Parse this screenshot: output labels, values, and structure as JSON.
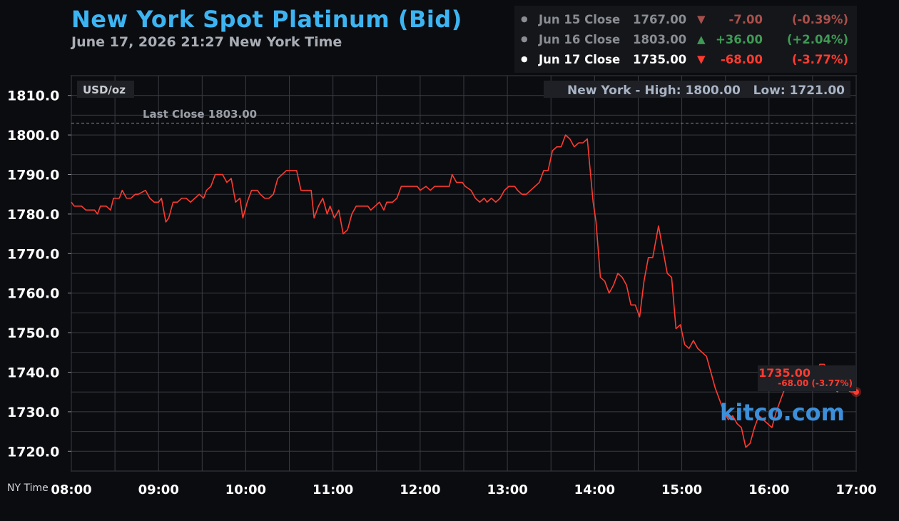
{
  "header": {
    "title": "New York Spot Platinum (Bid)",
    "subtitle": "June 17, 2026 21:27 New York Time"
  },
  "closes": [
    {
      "label": "Jun 15 Close",
      "value": "1767.00",
      "arrow": "▼",
      "change": "-7.00",
      "percent": "(-0.39%)",
      "dot": "●"
    },
    {
      "label": "Jun 16 Close",
      "value": "1803.00",
      "arrow": "▲",
      "change": "+36.00",
      "percent": "(+2.04%)",
      "dot": "●"
    },
    {
      "label": "Jun 17 Close",
      "value": "1735.00",
      "arrow": "▼",
      "change": "-68.00",
      "percent": "(-3.77%)",
      "dot": "●"
    }
  ],
  "colors": {
    "title": "#3db4f2",
    "line": "#ff3b30",
    "grid": "#3a3c42",
    "brand": "#3c8fd8",
    "up": "#3f9a55",
    "down": "#ff3b30"
  },
  "chart_data": {
    "type": "line",
    "title": "New York Spot Platinum (Bid)",
    "units_label": "USD/oz",
    "x_axis_label": "NY Time",
    "high_low_label": "New York - High: 1800.00   Low: 1721.00",
    "last_close_label": "Last Close 1803.00",
    "last_close": 1803.0,
    "current_price_label": "1735.00",
    "current_change_label": "-68.00 (-3.77%)",
    "brand": "kitco.com",
    "xlim": [
      "08:00",
      "17:00"
    ],
    "ylim": [
      1715,
      1815
    ],
    "x_ticks": [
      "08:00",
      "09:00",
      "10:00",
      "11:00",
      "12:00",
      "13:00",
      "14:00",
      "15:00",
      "16:00",
      "17:00"
    ],
    "y_ticks": [
      "1720.0",
      "1730.0",
      "1740.0",
      "1750.0",
      "1760.0",
      "1770.0",
      "1780.0",
      "1790.0",
      "1800.0",
      "1810.0"
    ],
    "grid": true,
    "series": [
      {
        "points": [
          [
            "08:00",
            1783
          ],
          [
            "08:02",
            1782
          ],
          [
            "08:07",
            1782
          ],
          [
            "08:10",
            1781
          ],
          [
            "08:14",
            1781
          ],
          [
            "08:16",
            1781
          ],
          [
            "08:18",
            1780
          ],
          [
            "08:20",
            1782
          ],
          [
            "08:24",
            1782
          ],
          [
            "08:27",
            1781
          ],
          [
            "08:29",
            1784
          ],
          [
            "08:33",
            1784
          ],
          [
            "08:35",
            1786
          ],
          [
            "08:38",
            1784
          ],
          [
            "08:41",
            1784
          ],
          [
            "08:44",
            1785
          ],
          [
            "08:46",
            1785
          ],
          [
            "08:51",
            1786
          ],
          [
            "08:54",
            1784
          ],
          [
            "08:57",
            1783
          ],
          [
            "09:00",
            1783
          ],
          [
            "09:02",
            1784
          ],
          [
            "09:05",
            1778
          ],
          [
            "09:07",
            1779
          ],
          [
            "09:10",
            1783
          ],
          [
            "09:13",
            1783
          ],
          [
            "09:16",
            1784
          ],
          [
            "09:19",
            1784
          ],
          [
            "09:22",
            1783
          ],
          [
            "09:25",
            1784
          ],
          [
            "09:28",
            1785
          ],
          [
            "09:31",
            1784
          ],
          [
            "09:33",
            1786
          ],
          [
            "09:36",
            1787
          ],
          [
            "09:39",
            1790
          ],
          [
            "09:44",
            1790
          ],
          [
            "09:47",
            1788
          ],
          [
            "09:50",
            1789
          ],
          [
            "09:53",
            1783
          ],
          [
            "09:56",
            1784
          ],
          [
            "09:58",
            1779
          ],
          [
            "10:01",
            1783
          ],
          [
            "10:04",
            1786
          ],
          [
            "10:08",
            1786
          ],
          [
            "10:10",
            1785
          ],
          [
            "10:13",
            1784
          ],
          [
            "10:16",
            1784
          ],
          [
            "10:19",
            1785
          ],
          [
            "10:22",
            1789
          ],
          [
            "10:25",
            1790
          ],
          [
            "10:28",
            1791
          ],
          [
            "10:35",
            1791
          ],
          [
            "10:38",
            1786
          ],
          [
            "10:45",
            1786
          ],
          [
            "10:47",
            1779
          ],
          [
            "10:50",
            1782
          ],
          [
            "10:53",
            1784
          ],
          [
            "10:56",
            1780
          ],
          [
            "10:58",
            1782
          ],
          [
            "11:01",
            1779
          ],
          [
            "11:04",
            1781
          ],
          [
            "11:07",
            1775
          ],
          [
            "11:10",
            1776
          ],
          [
            "11:13",
            1780
          ],
          [
            "11:16",
            1782
          ],
          [
            "11:19",
            1782
          ],
          [
            "11:24",
            1782
          ],
          [
            "11:26",
            1781
          ],
          [
            "11:29",
            1782
          ],
          [
            "11:32",
            1783
          ],
          [
            "11:35",
            1781
          ],
          [
            "11:37",
            1783
          ],
          [
            "11:41",
            1783
          ],
          [
            "11:44",
            1784
          ],
          [
            "11:47",
            1787
          ],
          [
            "11:53",
            1787
          ],
          [
            "11:58",
            1787
          ],
          [
            "12:00",
            1786
          ],
          [
            "12:04",
            1787
          ],
          [
            "12:07",
            1786
          ],
          [
            "12:10",
            1787
          ],
          [
            "12:20",
            1787
          ],
          [
            "12:22",
            1790
          ],
          [
            "12:25",
            1788
          ],
          [
            "12:29",
            1788
          ],
          [
            "12:31",
            1787
          ],
          [
            "12:35",
            1786
          ],
          [
            "12:38",
            1784
          ],
          [
            "12:41",
            1783
          ],
          [
            "12:44",
            1784
          ],
          [
            "12:46",
            1783
          ],
          [
            "12:49",
            1784
          ],
          [
            "12:52",
            1783
          ],
          [
            "12:55",
            1784
          ],
          [
            "12:58",
            1786
          ],
          [
            "13:01",
            1787
          ],
          [
            "13:05",
            1787
          ],
          [
            "13:07",
            1786
          ],
          [
            "13:10",
            1785
          ],
          [
            "13:13",
            1785
          ],
          [
            "13:16",
            1786
          ],
          [
            "13:19",
            1787
          ],
          [
            "13:22",
            1788
          ],
          [
            "13:25",
            1791
          ],
          [
            "13:28",
            1791
          ],
          [
            "13:31",
            1796
          ],
          [
            "13:34",
            1797
          ],
          [
            "13:37",
            1797
          ],
          [
            "13:40",
            1800
          ],
          [
            "13:43",
            1799
          ],
          [
            "13:46",
            1797
          ],
          [
            "13:49",
            1798
          ],
          [
            "13:52",
            1798
          ],
          [
            "13:55",
            1799
          ],
          [
            "13:59",
            1783
          ],
          [
            "14:01",
            1778
          ],
          [
            "14:04",
            1764
          ],
          [
            "14:07",
            1763
          ],
          [
            "14:10",
            1760
          ],
          [
            "14:13",
            1762
          ],
          [
            "14:16",
            1765
          ],
          [
            "14:19",
            1764
          ],
          [
            "14:22",
            1762
          ],
          [
            "14:25",
            1757
          ],
          [
            "14:28",
            1757
          ],
          [
            "14:31",
            1754
          ],
          [
            "14:34",
            1763
          ],
          [
            "14:37",
            1769
          ],
          [
            "14:40",
            1769
          ],
          [
            "14:44",
            1777
          ],
          [
            "14:47",
            1771
          ],
          [
            "14:50",
            1765
          ],
          [
            "14:53",
            1764
          ],
          [
            "14:56",
            1751
          ],
          [
            "14:59",
            1752
          ],
          [
            "15:02",
            1747
          ],
          [
            "15:05",
            1746
          ],
          [
            "15:08",
            1748
          ],
          [
            "15:11",
            1746
          ],
          [
            "15:14",
            1745
          ],
          [
            "15:17",
            1744
          ],
          [
            "15:20",
            1740
          ],
          [
            "15:23",
            1736
          ],
          [
            "15:26",
            1733
          ],
          [
            "15:29",
            1730
          ],
          [
            "15:32",
            1728
          ],
          [
            "15:35",
            1729
          ],
          [
            "15:38",
            1727
          ],
          [
            "15:41",
            1726
          ],
          [
            "15:44",
            1721
          ],
          [
            "15:47",
            1722
          ],
          [
            "15:50",
            1726
          ],
          [
            "15:53",
            1729
          ],
          [
            "15:56",
            1728
          ],
          [
            "15:59",
            1727
          ],
          [
            "16:02",
            1726
          ],
          [
            "16:05",
            1730
          ],
          [
            "16:08",
            1733
          ],
          [
            "16:11",
            1736
          ],
          [
            "16:14",
            1740
          ],
          [
            "16:17",
            1741
          ],
          [
            "16:20",
            1738
          ],
          [
            "16:23",
            1738
          ],
          [
            "16:26",
            1739
          ],
          [
            "16:29",
            1740
          ],
          [
            "16:32",
            1739
          ],
          [
            "16:35",
            1742
          ],
          [
            "16:38",
            1742
          ],
          [
            "16:41",
            1740
          ],
          [
            "16:44",
            1737
          ],
          [
            "16:47",
            1735
          ],
          [
            "16:50",
            1737
          ],
          [
            "16:53",
            1736
          ],
          [
            "16:56",
            1735
          ],
          [
            "17:00",
            1735
          ]
        ]
      }
    ]
  }
}
